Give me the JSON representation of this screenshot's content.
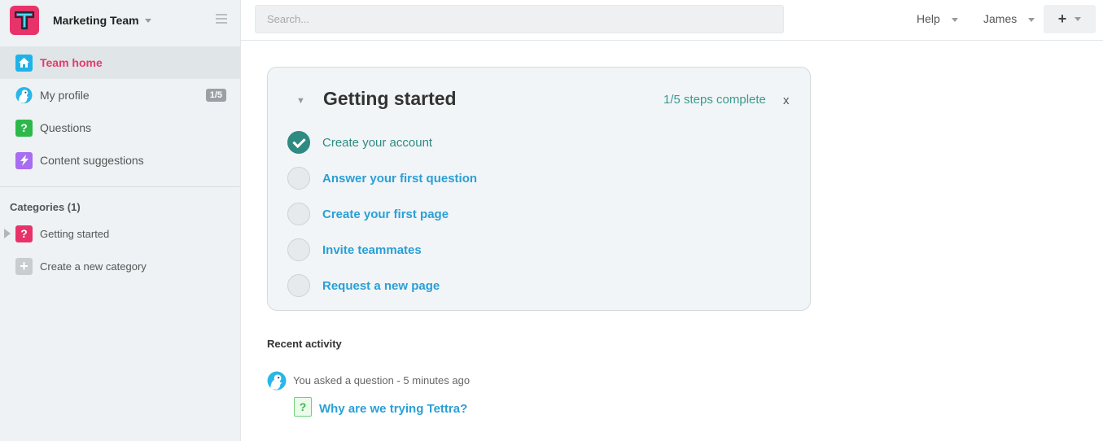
{
  "sidebar": {
    "team_name": "Marketing Team",
    "nav": [
      {
        "label": "Team home",
        "icon": "home-icon",
        "color": "#1eb3e8"
      },
      {
        "label": "My profile",
        "icon": "avatar-icon",
        "badge": "1/5"
      },
      {
        "label": "Questions",
        "icon": "question-icon",
        "color": "#2db84b"
      },
      {
        "label": "Content suggestions",
        "icon": "lightning-icon",
        "color": "#a86df0"
      }
    ],
    "categories_title": "Categories (1)",
    "categories": [
      {
        "label": "Getting started",
        "icon": "question-icon",
        "color": "#e8336a"
      },
      {
        "label": "Create a new category",
        "icon": "plus-icon",
        "color": "#c8cdd0"
      }
    ]
  },
  "topbar": {
    "search_placeholder": "Search...",
    "help_label": "Help",
    "user_label": "James",
    "add_label": "+"
  },
  "getting_started": {
    "title": "Getting started",
    "progress": "1/5 steps complete",
    "close_label": "x",
    "toggle_label": "▼",
    "steps": [
      {
        "label": "Create your account",
        "done": true
      },
      {
        "label": "Answer your first question",
        "done": false
      },
      {
        "label": "Create your first page",
        "done": false
      },
      {
        "label": "Invite teammates",
        "done": false
      },
      {
        "label": "Request a new page",
        "done": false
      }
    ]
  },
  "recent": {
    "title": "Recent activity",
    "items": [
      {
        "text": "You asked a question - 5 minutes ago",
        "link": "Why are we trying Tettra?",
        "icon": "question-icon"
      }
    ]
  },
  "colors": {
    "accent": "#e33b6b",
    "link": "#2a9fd6",
    "done": "#2f8a82"
  }
}
